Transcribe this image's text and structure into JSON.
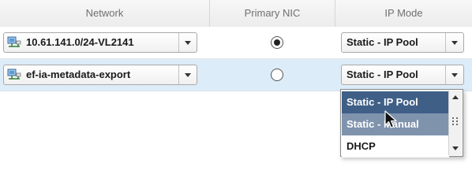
{
  "table": {
    "columns": {
      "network": "Network",
      "primary_nic": "Primary NIC",
      "ip_mode": "IP Mode"
    },
    "rows": [
      {
        "network": "10.61.141.0/24-VL2141",
        "network_icon": "network-icon",
        "primary_nic_selected": true,
        "ip_mode": "Static - IP Pool"
      },
      {
        "network": "ef-ia-metadata-export",
        "network_icon": "network-icon",
        "primary_nic_selected": false,
        "ip_mode": "Static - IP Pool"
      }
    ]
  },
  "ip_mode_dropdown": {
    "open": true,
    "options": [
      "Static - IP Pool",
      "Static - Manual",
      "DHCP"
    ],
    "selected": "Static - IP Pool",
    "hovered": "Static - Manual"
  },
  "colors": {
    "selected_row": "#dcecf8",
    "option_selected": "#3f5f86",
    "option_hover": "#7f93ad"
  }
}
